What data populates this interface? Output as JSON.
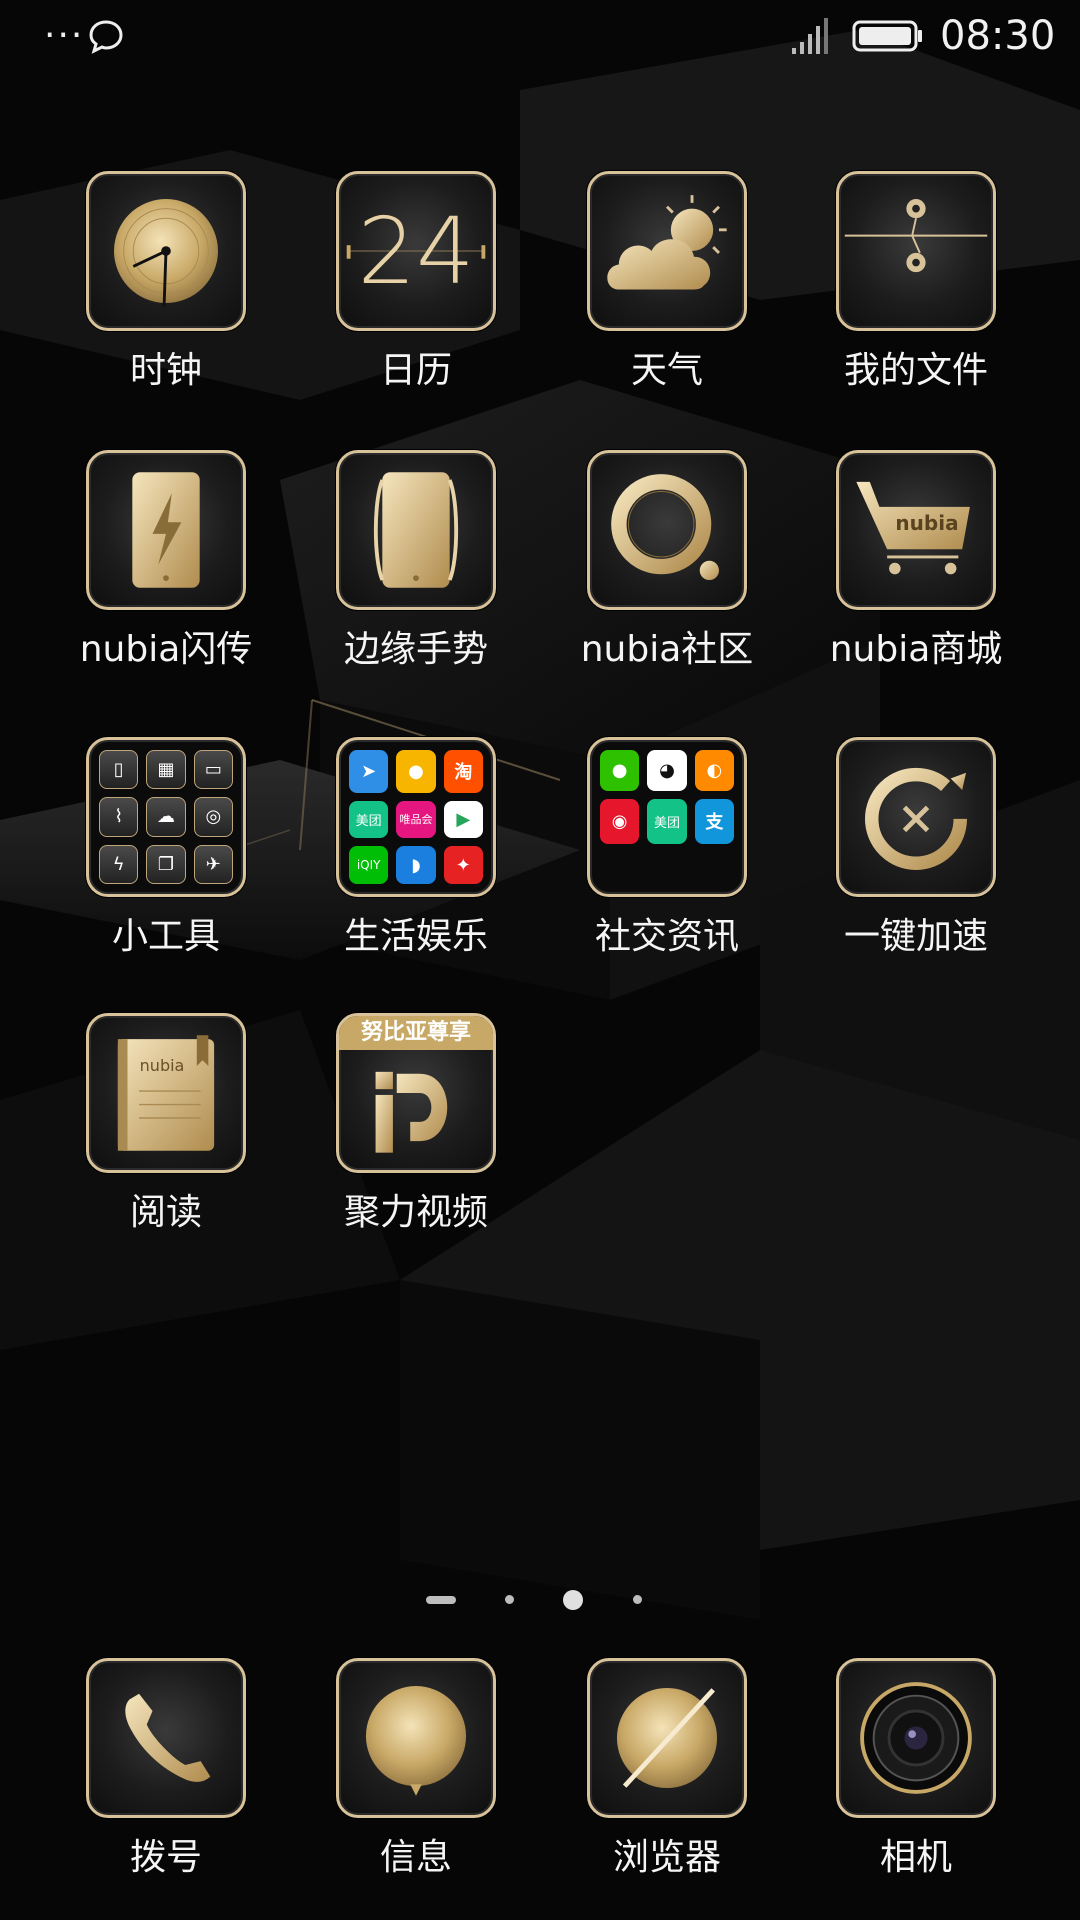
{
  "status_bar": {
    "time": "08:30",
    "more_icon": "ellipsis-icon",
    "notification_icon": "message-bubble-icon",
    "signal_icon": "signal-icon",
    "battery_icon": "battery-full-icon"
  },
  "colors": {
    "gold": "#d7c29a",
    "background": "#070707",
    "label": "#f5f5f5"
  },
  "apps": {
    "clock": "时钟",
    "calendar": "日历",
    "calendar_date": "24",
    "weather": "天气",
    "files": "我的文件",
    "nubia_flash": "nubia闪传",
    "edge_gesture": "边缘手势",
    "nubia_community": "nubia社区",
    "nubia_store": "nubia商城",
    "nubia_store_logo": "nubia",
    "tools": "小工具",
    "life_entertainment": "生活娱乐",
    "social_news": "社交资讯",
    "speed_boost": "一键加速",
    "reading": "阅读",
    "reading_logo": "nubia",
    "juli_video": "聚力视频",
    "juli_video_banner": "努比亚尊享"
  },
  "folders": {
    "life_entertainment_items": [
      "feiyu",
      "suning",
      "taobao",
      "meituan",
      "vip",
      "video-play",
      "iqiyi",
      "ctrip",
      "tuniu"
    ],
    "life_entertainment_text": {
      "taobao": "淘",
      "meituan": "美团",
      "vip": "唯品会",
      "iqiyi": "iQIY"
    },
    "social_items": [
      "wechat",
      "qq",
      "uc-browser",
      "weibo",
      "meituan",
      "alipay"
    ],
    "social_text": {
      "meituan": "美团",
      "alipay": "支"
    }
  },
  "dock": {
    "dialer": "拨号",
    "messages": "信息",
    "browser": "浏览器",
    "camera": "相机"
  },
  "pager": {
    "page_count": 4,
    "current_page": 3
  }
}
